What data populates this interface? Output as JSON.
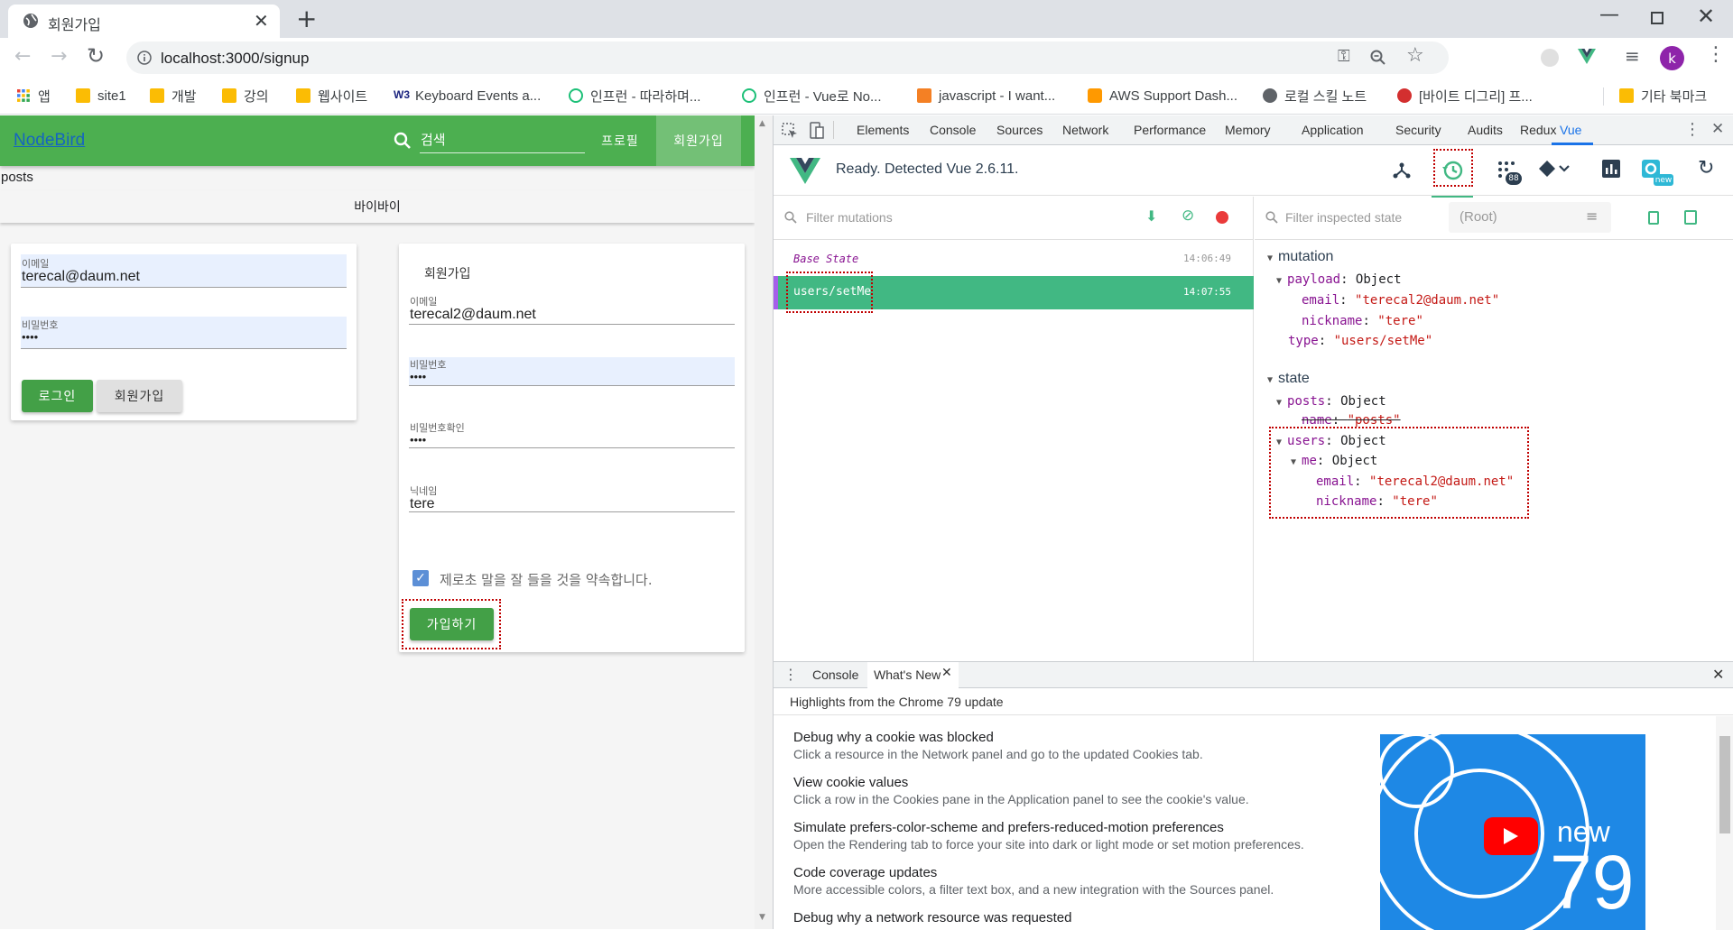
{
  "browser": {
    "tab_title": "회원가입",
    "url": "localhost:3000/signup",
    "profile_initial": "k",
    "bookmarks": [
      "앱",
      "site1",
      "개발",
      "강의",
      "웹사이트",
      "Keyboard Events a...",
      "인프런 - 따라하며...",
      "인프런 - Vue로 No...",
      "javascript - I want...",
      "AWS Support Dash...",
      "로컬 스킬 노트",
      "[바이트 디그리] 프...",
      "기타 북마크"
    ]
  },
  "app": {
    "logo": "NodeBird",
    "search_placeholder": "검색",
    "nav_profile": "프로필",
    "nav_signup": "회원가입",
    "posts_label": "posts",
    "bye_label": "바이바이",
    "login": {
      "email_label": "이메일",
      "email_value": "terecal@daum.net",
      "password_label": "비밀번호",
      "password_value": "••••",
      "login_button": "로그인",
      "signup_button": "회원가입"
    },
    "signup": {
      "title": "회원가입",
      "email_label": "이메일",
      "email_value": "terecal2@daum.net",
      "password_label": "비밀번호",
      "password_value": "••••",
      "password_check_label": "비밀번호확인",
      "password_check_value": "••••",
      "nickname_label": "닉네임",
      "nickname_value": "tere",
      "terms_label": "제로초 말을 잘 들을 것을 약속합니다.",
      "terms_checked": true,
      "submit_button": "가입하기"
    }
  },
  "devtools": {
    "tabs": [
      "Elements",
      "Console",
      "Sources",
      "Network",
      "Performance",
      "Memory",
      "Application",
      "Security",
      "Audits",
      "Redux",
      "Vue"
    ],
    "active_tab": "Vue",
    "vue_status": "Ready. Detected Vue 2.6.11.",
    "vuex_badge": "88",
    "settings_badge": "new",
    "filter_mutations_placeholder": "Filter mutations",
    "filter_state_placeholder": "Filter inspected state",
    "root_select": "(Root)",
    "mutations": [
      {
        "name": "Base State",
        "time": "14:06:49"
      },
      {
        "name": "users/setMe",
        "time": "14:07:55",
        "selected": true
      }
    ],
    "state_tree": {
      "mutation_header": "mutation",
      "payload_key": "payload",
      "payload_type": "Object",
      "email_key": "email",
      "payload_email": "\"terecal2@daum.net\"",
      "nickname_key": "nickname",
      "payload_nickname": "\"tere\"",
      "type_key": "type",
      "type_value": "\"users/setMe\"",
      "state_header": "state",
      "posts_key": "posts",
      "posts_type": "Object",
      "name_key": "name",
      "posts_name": "\"posts\"",
      "users_key": "users",
      "users_type": "Object",
      "me_key": "me",
      "me_type": "Object",
      "me_email": "\"terecal2@daum.net\"",
      "me_nickname": "\"tere\""
    },
    "drawer": {
      "tabs": [
        "Console",
        "What's New"
      ],
      "active": "What's New",
      "headline": "Highlights from the Chrome 79 update",
      "items": [
        {
          "title": "Debug why a cookie was blocked",
          "desc": "Click a resource in the Network panel and go to the updated Cookies tab."
        },
        {
          "title": "View cookie values",
          "desc": "Click a row in the Cookies pane in the Application panel to see the cookie's value."
        },
        {
          "title": "Simulate prefers-color-scheme and prefers-reduced-motion preferences",
          "desc": "Open the Rendering tab to force your site into dark or light mode or set motion preferences."
        },
        {
          "title": "Code coverage updates",
          "desc": "More accessible colors, a filter text box, and a new integration with the Sources panel."
        },
        {
          "title": "Debug why a network resource was requested",
          "desc": ""
        }
      ],
      "video_new": "new",
      "video_num": "79"
    }
  }
}
